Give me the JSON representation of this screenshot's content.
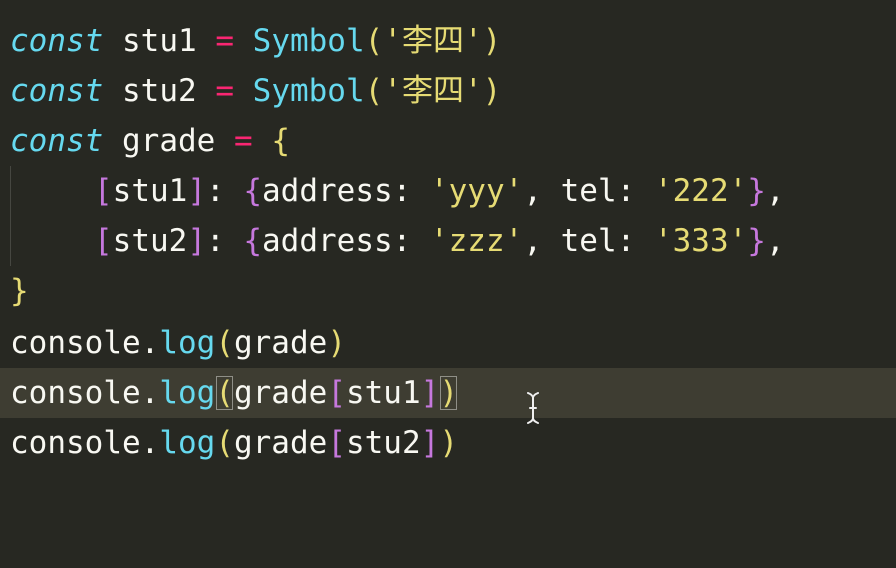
{
  "editor": {
    "lines": [
      {
        "tokens": [
          "const",
          " stu1 ",
          "=",
          " ",
          "Symbol",
          "(",
          "'李四'",
          ")"
        ]
      },
      {
        "tokens": [
          "const",
          " stu2 ",
          "=",
          " ",
          "Symbol",
          "(",
          "'李四'",
          ")"
        ]
      },
      {
        "tokens": [
          "const",
          " grade ",
          "=",
          " ",
          "{"
        ]
      },
      {
        "tokens": [
          "[",
          "stu1",
          "]",
          ": ",
          "{",
          "address: ",
          "'yyy'",
          ", tel: ",
          "'222'",
          "}",
          ","
        ]
      },
      {
        "tokens": [
          "[",
          "stu2",
          "]",
          ": ",
          "{",
          "address: ",
          "'zzz'",
          ", tel: ",
          "'333'",
          "}",
          ","
        ]
      },
      {
        "tokens": [
          "}"
        ]
      },
      {
        "tokens": [
          "console.",
          "log",
          "(",
          "grade",
          ")"
        ]
      },
      {
        "tokens": [
          "console.",
          "log",
          "(",
          "grade",
          "[",
          "stu1",
          "]",
          ")"
        ]
      },
      {
        "tokens": [
          "console.",
          "log",
          "(",
          "grade",
          "[",
          "stu2",
          "]",
          ")"
        ]
      }
    ],
    "active_line": 8,
    "cursor": "text-cursor-icon"
  },
  "colors": {
    "background": "#272822",
    "active_line": "#3e3d32",
    "keyword": "#66d9ef",
    "operator": "#f92672",
    "string": "#e6db74",
    "bracket_alt": "#c678dd",
    "text": "#f8f8f2"
  }
}
